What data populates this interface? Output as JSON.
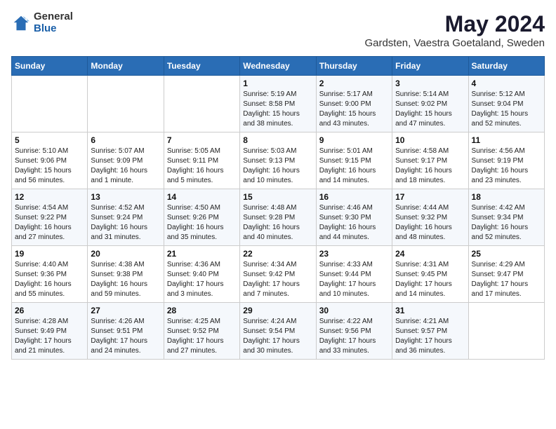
{
  "logo": {
    "general": "General",
    "blue": "Blue"
  },
  "title": "May 2024",
  "subtitle": "Gardsten, Vaestra Goetaland, Sweden",
  "headers": [
    "Sunday",
    "Monday",
    "Tuesday",
    "Wednesday",
    "Thursday",
    "Friday",
    "Saturday"
  ],
  "rows": [
    [
      {
        "day": "",
        "info": ""
      },
      {
        "day": "",
        "info": ""
      },
      {
        "day": "",
        "info": ""
      },
      {
        "day": "1",
        "info": "Sunrise: 5:19 AM\nSunset: 8:58 PM\nDaylight: 15 hours and 38 minutes."
      },
      {
        "day": "2",
        "info": "Sunrise: 5:17 AM\nSunset: 9:00 PM\nDaylight: 15 hours and 43 minutes."
      },
      {
        "day": "3",
        "info": "Sunrise: 5:14 AM\nSunset: 9:02 PM\nDaylight: 15 hours and 47 minutes."
      },
      {
        "day": "4",
        "info": "Sunrise: 5:12 AM\nSunset: 9:04 PM\nDaylight: 15 hours and 52 minutes."
      }
    ],
    [
      {
        "day": "5",
        "info": "Sunrise: 5:10 AM\nSunset: 9:06 PM\nDaylight: 15 hours and 56 minutes."
      },
      {
        "day": "6",
        "info": "Sunrise: 5:07 AM\nSunset: 9:09 PM\nDaylight: 16 hours and 1 minute."
      },
      {
        "day": "7",
        "info": "Sunrise: 5:05 AM\nSunset: 9:11 PM\nDaylight: 16 hours and 5 minutes."
      },
      {
        "day": "8",
        "info": "Sunrise: 5:03 AM\nSunset: 9:13 PM\nDaylight: 16 hours and 10 minutes."
      },
      {
        "day": "9",
        "info": "Sunrise: 5:01 AM\nSunset: 9:15 PM\nDaylight: 16 hours and 14 minutes."
      },
      {
        "day": "10",
        "info": "Sunrise: 4:58 AM\nSunset: 9:17 PM\nDaylight: 16 hours and 18 minutes."
      },
      {
        "day": "11",
        "info": "Sunrise: 4:56 AM\nSunset: 9:19 PM\nDaylight: 16 hours and 23 minutes."
      }
    ],
    [
      {
        "day": "12",
        "info": "Sunrise: 4:54 AM\nSunset: 9:22 PM\nDaylight: 16 hours and 27 minutes."
      },
      {
        "day": "13",
        "info": "Sunrise: 4:52 AM\nSunset: 9:24 PM\nDaylight: 16 hours and 31 minutes."
      },
      {
        "day": "14",
        "info": "Sunrise: 4:50 AM\nSunset: 9:26 PM\nDaylight: 16 hours and 35 minutes."
      },
      {
        "day": "15",
        "info": "Sunrise: 4:48 AM\nSunset: 9:28 PM\nDaylight: 16 hours and 40 minutes."
      },
      {
        "day": "16",
        "info": "Sunrise: 4:46 AM\nSunset: 9:30 PM\nDaylight: 16 hours and 44 minutes."
      },
      {
        "day": "17",
        "info": "Sunrise: 4:44 AM\nSunset: 9:32 PM\nDaylight: 16 hours and 48 minutes."
      },
      {
        "day": "18",
        "info": "Sunrise: 4:42 AM\nSunset: 9:34 PM\nDaylight: 16 hours and 52 minutes."
      }
    ],
    [
      {
        "day": "19",
        "info": "Sunrise: 4:40 AM\nSunset: 9:36 PM\nDaylight: 16 hours and 55 minutes."
      },
      {
        "day": "20",
        "info": "Sunrise: 4:38 AM\nSunset: 9:38 PM\nDaylight: 16 hours and 59 minutes."
      },
      {
        "day": "21",
        "info": "Sunrise: 4:36 AM\nSunset: 9:40 PM\nDaylight: 17 hours and 3 minutes."
      },
      {
        "day": "22",
        "info": "Sunrise: 4:34 AM\nSunset: 9:42 PM\nDaylight: 17 hours and 7 minutes."
      },
      {
        "day": "23",
        "info": "Sunrise: 4:33 AM\nSunset: 9:44 PM\nDaylight: 17 hours and 10 minutes."
      },
      {
        "day": "24",
        "info": "Sunrise: 4:31 AM\nSunset: 9:45 PM\nDaylight: 17 hours and 14 minutes."
      },
      {
        "day": "25",
        "info": "Sunrise: 4:29 AM\nSunset: 9:47 PM\nDaylight: 17 hours and 17 minutes."
      }
    ],
    [
      {
        "day": "26",
        "info": "Sunrise: 4:28 AM\nSunset: 9:49 PM\nDaylight: 17 hours and 21 minutes."
      },
      {
        "day": "27",
        "info": "Sunrise: 4:26 AM\nSunset: 9:51 PM\nDaylight: 17 hours and 24 minutes."
      },
      {
        "day": "28",
        "info": "Sunrise: 4:25 AM\nSunset: 9:52 PM\nDaylight: 17 hours and 27 minutes."
      },
      {
        "day": "29",
        "info": "Sunrise: 4:24 AM\nSunset: 9:54 PM\nDaylight: 17 hours and 30 minutes."
      },
      {
        "day": "30",
        "info": "Sunrise: 4:22 AM\nSunset: 9:56 PM\nDaylight: 17 hours and 33 minutes."
      },
      {
        "day": "31",
        "info": "Sunrise: 4:21 AM\nSunset: 9:57 PM\nDaylight: 17 hours and 36 minutes."
      },
      {
        "day": "",
        "info": ""
      }
    ]
  ]
}
